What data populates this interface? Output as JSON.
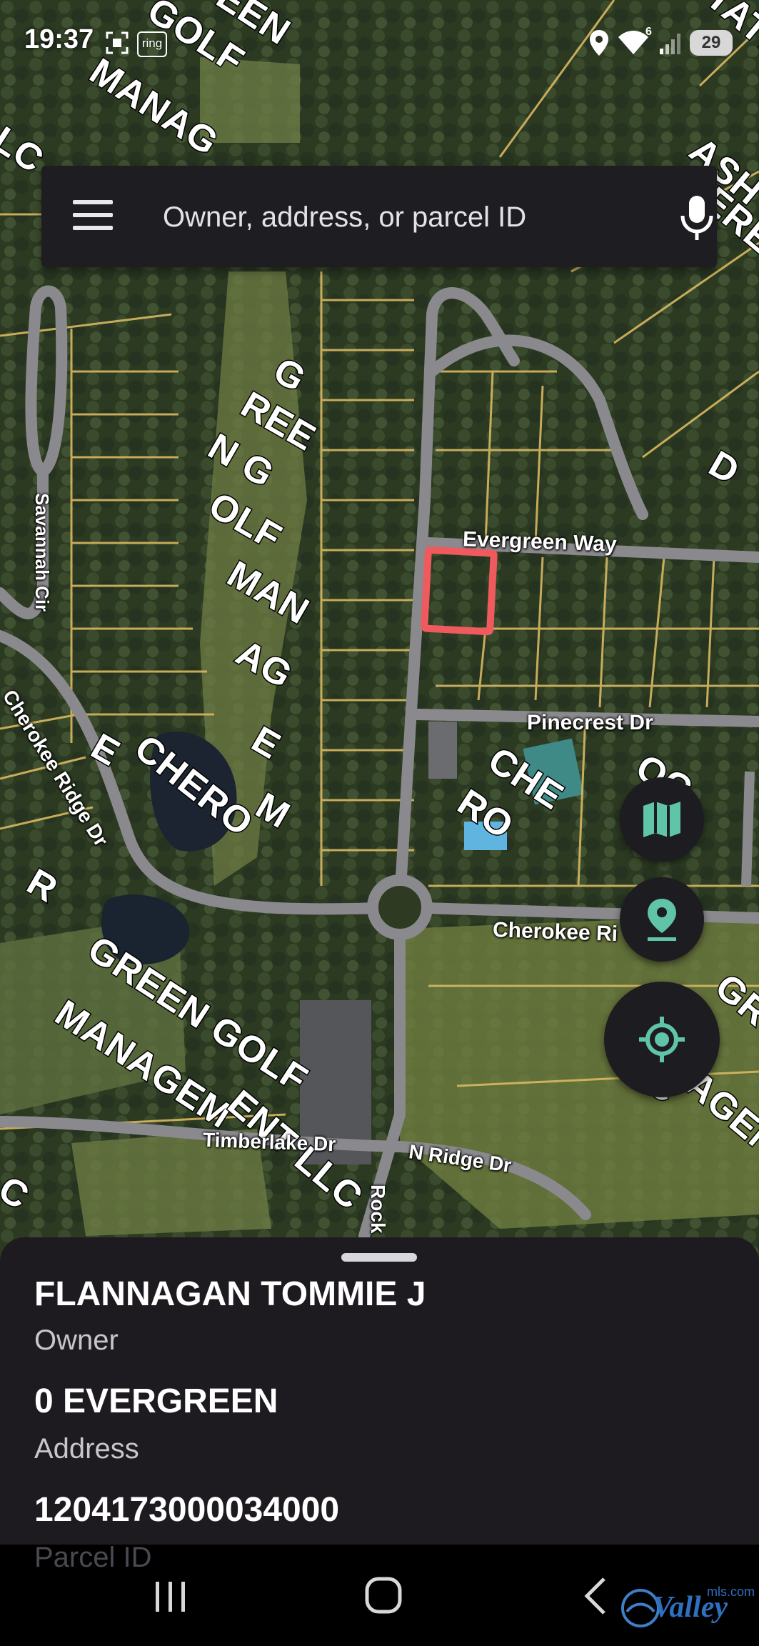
{
  "status_bar": {
    "time": "19:37",
    "notification_app": "ring",
    "wifi_badge": "6",
    "battery": "29",
    "icons": [
      "screenshot-icon",
      "ring-app-icon",
      "location-icon",
      "wifi-icon",
      "signal-icon",
      "battery-icon"
    ]
  },
  "search": {
    "placeholder": "Owner, address, or parcel ID",
    "value": "",
    "menu_icon": "hamburger-menu-icon",
    "voice_icon": "microphone-icon"
  },
  "map": {
    "streets": {
      "evergreen_way": "Evergreen Way",
      "pinecrest_dr": "Pinecrest Dr",
      "cherokee_ridge_dr_left": "Cherokee Ridge Dr",
      "cherokee_ridge_dr_right": "Cherokee Ri",
      "savannah_cir": "Savannah Cir",
      "timberlake_dr": "Timberlake Dr",
      "n_ridge_dr": "N Ridge Dr",
      "rock": "Rock"
    },
    "owner_overlays": {
      "top_golf": "GOLF",
      "top_green": "EEN",
      "top_manag": "MANAG",
      "top_lc": "LC",
      "top_right_state": "STATE",
      "top_right_ash": "ASH",
      "top_right_eree": "EREE",
      "mid_g": "G",
      "mid_ree": "REE",
      "mid_n_g": "N G",
      "mid_olf": "OLF",
      "mid_man": "MAN",
      "mid_ag": "AG",
      "mid_e": "E",
      "mid_m": "M",
      "right_d": "D",
      "chero": "CHERO",
      "che": "CHE",
      "ro": "RO",
      "left_e": "E",
      "left_r": "R",
      "bottom_green_golf": "GREEN GOLF",
      "bottom_managem": "MANAGEM",
      "bottom_ent_llc": "ENT LLC",
      "bottom_c": "C",
      "right_gr": "GR",
      "right_llc": "LLC",
      "right_agen": "AGEN",
      "right_oc": "OC"
    },
    "selected_parcel_color": "#ef5a5f",
    "parcel_line_color": "#d8b861",
    "road_color": "#8a8a8e"
  },
  "fabs": {
    "layers_icon": "map-layers-icon",
    "pin_icon": "map-pin-icon",
    "locate_icon": "my-location-icon",
    "accent": "#5fc4a8"
  },
  "sheet": {
    "owner_value": "FLANNAGAN TOMMIE J",
    "owner_label": "Owner",
    "address_value": "0 EVERGREEN",
    "address_label": "Address",
    "parcel_value": "1204173000034000",
    "parcel_label": "Parcel ID"
  },
  "nav": {
    "recents_icon": "recent-apps-icon",
    "home_icon": "home-icon",
    "back_icon": "back-icon"
  },
  "watermark": {
    "brand": "Valley",
    "suffix": "mls.com"
  }
}
